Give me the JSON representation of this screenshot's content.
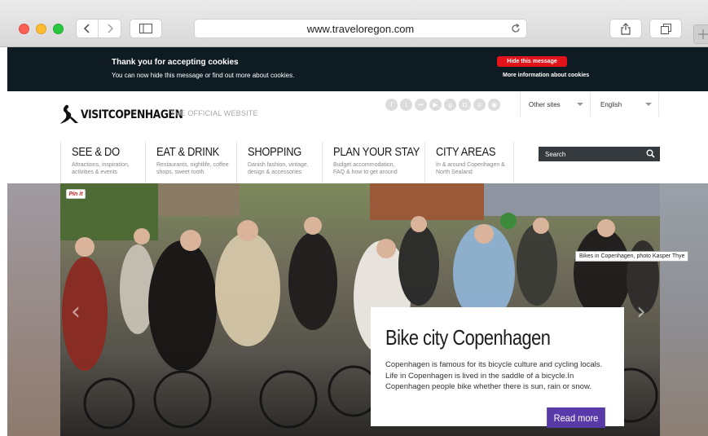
{
  "browser": {
    "url": "www.traveloregon.com"
  },
  "cookie_bar": {
    "title": "Thank you for accepting cookies",
    "text": "You can now hide this message or find out more about cookies.",
    "hide_button": "Hide this message",
    "more_link": "More information about cookies",
    "hide_color": "#e2131b"
  },
  "header": {
    "logo_text": "VISITCOPENHAGEN",
    "logo_subtitle": "THE OFFICIAL WEBSITE",
    "social_icons": [
      "facebook-icon",
      "twitter-icon",
      "flickr-icon",
      "youtube-icon",
      "google-plus-icon",
      "instagram-icon",
      "pinterest-icon",
      "foursquare-icon"
    ],
    "other_sites": "Other sites",
    "language": "English"
  },
  "menu": [
    {
      "title": "SEE & DO",
      "subtitle": "Attractions, inspiration, activities & events"
    },
    {
      "title": "EAT & DRINK",
      "subtitle": "Restaurants, nightlife, coffee shops, sweet tooth"
    },
    {
      "title": "SHOPPING",
      "subtitle": "Danish fashion, vintage, design & accessories"
    },
    {
      "title": "PLAN YOUR STAY",
      "subtitle": "Budget accommodation, FAQ & how to get around"
    },
    {
      "title": "CITY AREAS",
      "subtitle": "In & around Copenhagen & North Sealand"
    }
  ],
  "search": {
    "label": "Search"
  },
  "hero": {
    "pin_label": "Pin it",
    "caption": "Bikes in Copenhagen, photo Kasper Thye",
    "heading": "Bike city Copenhagen",
    "body": "Copenhagen is famous for its bicycle culture and cycling locals. Life in Copenhagen is lived in the saddle of a bicycle.In Copenhagen people bike whether there is sun, rain or snow.",
    "cta": "Read more",
    "cta_color": "#5a3aa8"
  }
}
